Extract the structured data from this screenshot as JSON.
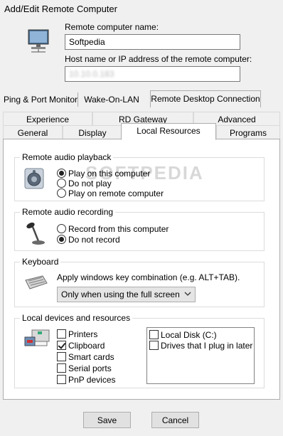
{
  "window": {
    "title": "Add/Edit Remote Computer"
  },
  "fields": {
    "name_label": "Remote computer name:",
    "name_value": "Softpedia",
    "host_label": "Host name or IP address of the remote computer:",
    "host_value": "10.10.0.183"
  },
  "top_tabs": [
    "Ping & Port Monitor",
    "Wake-On-LAN",
    "Remote Desktop Connection"
  ],
  "rdp_tabs_row1": [
    "Experience",
    "RD Gateway",
    "Advanced"
  ],
  "rdp_tabs_row2": [
    "General",
    "Display",
    "Local Resources",
    "Programs"
  ],
  "watermark": "SOFTPEDIA",
  "audio_playback": {
    "title": "Remote audio playback",
    "options": [
      "Play on this computer",
      "Do not play",
      "Play on remote computer"
    ],
    "selected": 0
  },
  "audio_recording": {
    "title": "Remote audio recording",
    "options": [
      "Record from this computer",
      "Do not record"
    ],
    "selected": 1
  },
  "keyboard": {
    "title": "Keyboard",
    "description": "Apply windows key combination (e.g. ALT+TAB).",
    "selected_option": "Only when using the full screen"
  },
  "devices": {
    "title": "Local devices and resources",
    "checkboxes": [
      {
        "label": "Printers",
        "checked": false
      },
      {
        "label": "Clipboard",
        "checked": true
      },
      {
        "label": "Smart cards",
        "checked": false
      },
      {
        "label": "Serial ports",
        "checked": false
      },
      {
        "label": "PnP devices",
        "checked": false
      }
    ],
    "drives": [
      {
        "label": "Local Disk (C:)",
        "checked": false
      },
      {
        "label": "Drives that I plug in later",
        "checked": false
      }
    ]
  },
  "buttons": {
    "save": "Save",
    "cancel": "Cancel"
  }
}
